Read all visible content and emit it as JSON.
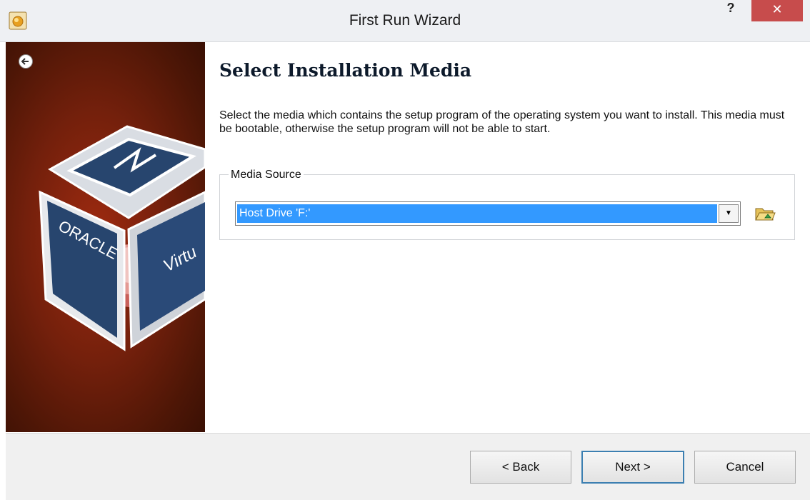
{
  "window": {
    "title": "First Run Wizard",
    "help_label": "?",
    "close_label": "✕"
  },
  "banner": {
    "logo_text": "ORACLE",
    "logo_text_2": "Virtu"
  },
  "page": {
    "heading": "Select Installation Media",
    "description": "Select the media which contains the setup program of the operating system you want to install. This media must be bootable, otherwise the setup program will not be able to start."
  },
  "media_source": {
    "group_label": "Media Source",
    "selected_value": "Host Drive 'F:'",
    "dropdown_arrow": "▼"
  },
  "buttons": {
    "back": "< Back",
    "next": "Next >",
    "cancel": "Cancel"
  },
  "colors": {
    "selection": "#3399ff",
    "close": "#c74c4c",
    "banner": "#74200c",
    "focus_border": "#3c7fb1"
  }
}
